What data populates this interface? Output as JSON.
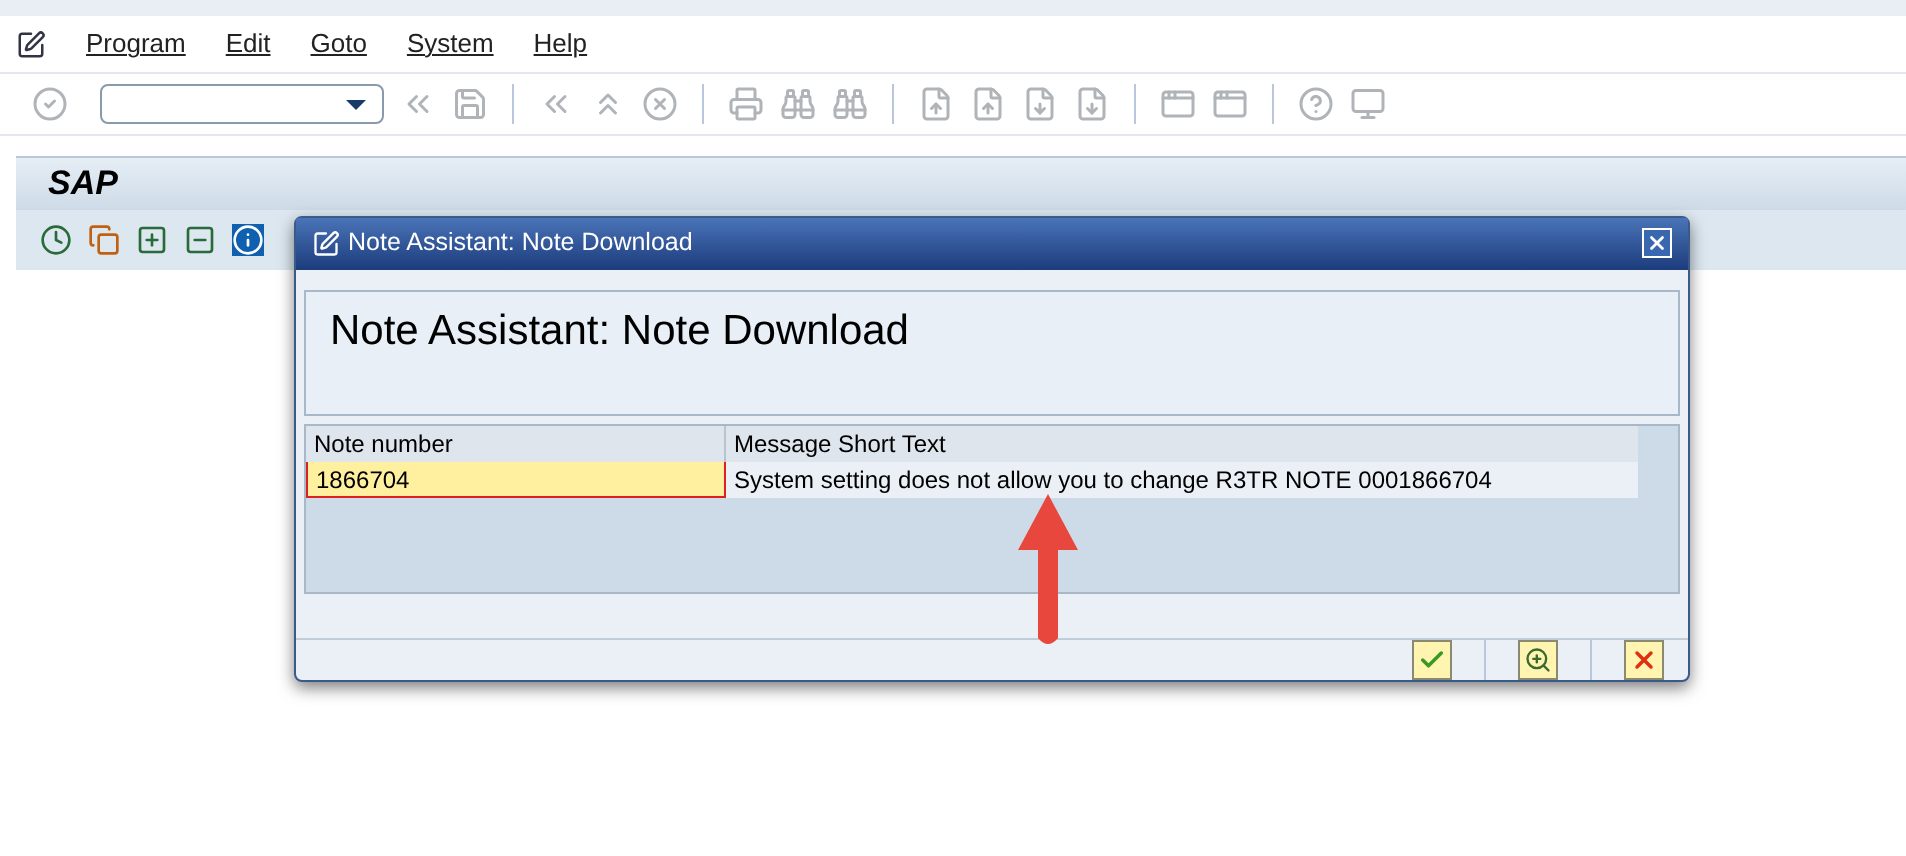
{
  "menu": [
    "Program",
    "Edit",
    "Goto",
    "System",
    "Help"
  ],
  "screen_title": "SAP",
  "dialog": {
    "title": "Note Assistant: Note Download",
    "heading": "Note Assistant: Note Download",
    "table": {
      "columns": [
        "Note number",
        "Message Short Text"
      ],
      "rows": [
        {
          "note_number": "1866704",
          "message": "System setting does not allow you to change R3TR NOTE 0001866704"
        }
      ]
    }
  }
}
